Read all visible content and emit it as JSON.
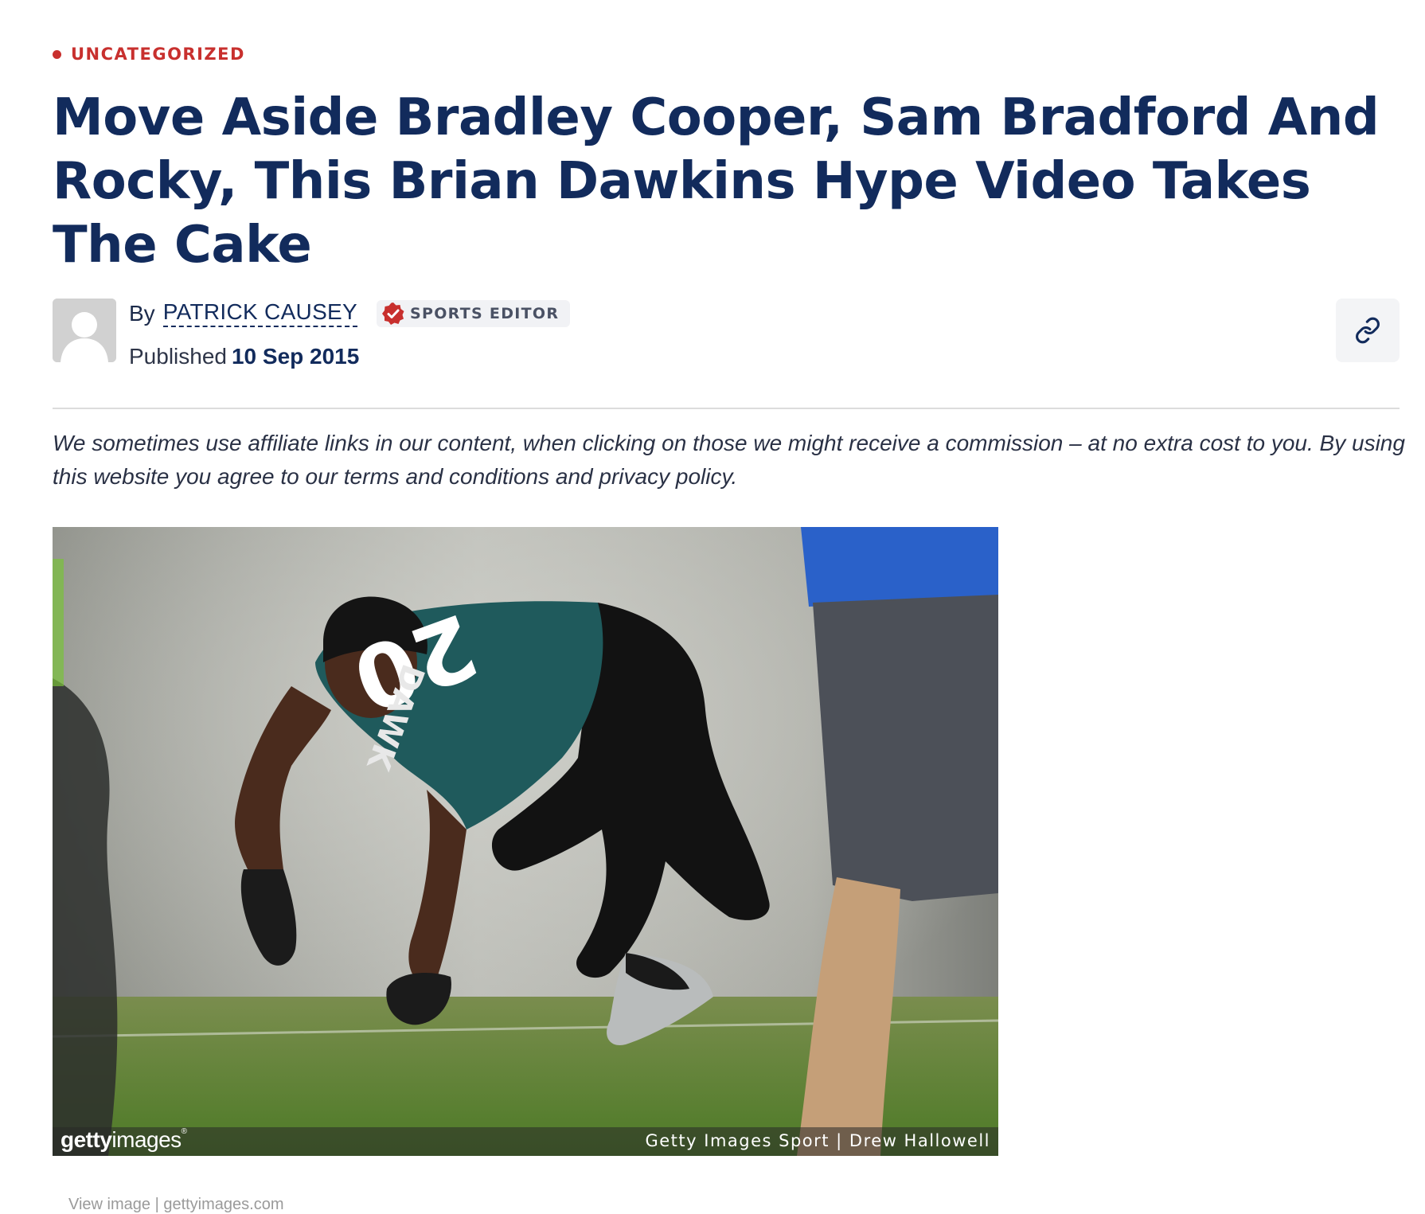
{
  "article": {
    "category": "UNCATEGORIZED",
    "title": "Move Aside Bradley Cooper, Sam Bradford And Rocky, This Brian Dawkins Hype Video Takes The Cake",
    "byline": {
      "by_label": "By",
      "author": "PATRICK CAUSEY",
      "role_badge": "SPORTS EDITOR",
      "published_label": "Published",
      "published_date": "10 Sep 2015"
    },
    "share_icon": "link-icon",
    "disclaimer": "We sometimes use affiliate links in our content, when clicking on those we might receive a commission – at no extra cost to you. By using this website you agree to our terms and conditions and privacy policy.",
    "image": {
      "logo_text_bold": "getty",
      "logo_text_regular": "images",
      "credit": "Getty Images Sport | Drew Hallowell",
      "jersey_number": "20",
      "jersey_name": "DAWK",
      "view_link": "View image | gettyimages.com"
    }
  },
  "colors": {
    "accent_red": "#c8302e",
    "title_navy": "#122b5c",
    "eagles_green": "#1f5a5c"
  }
}
